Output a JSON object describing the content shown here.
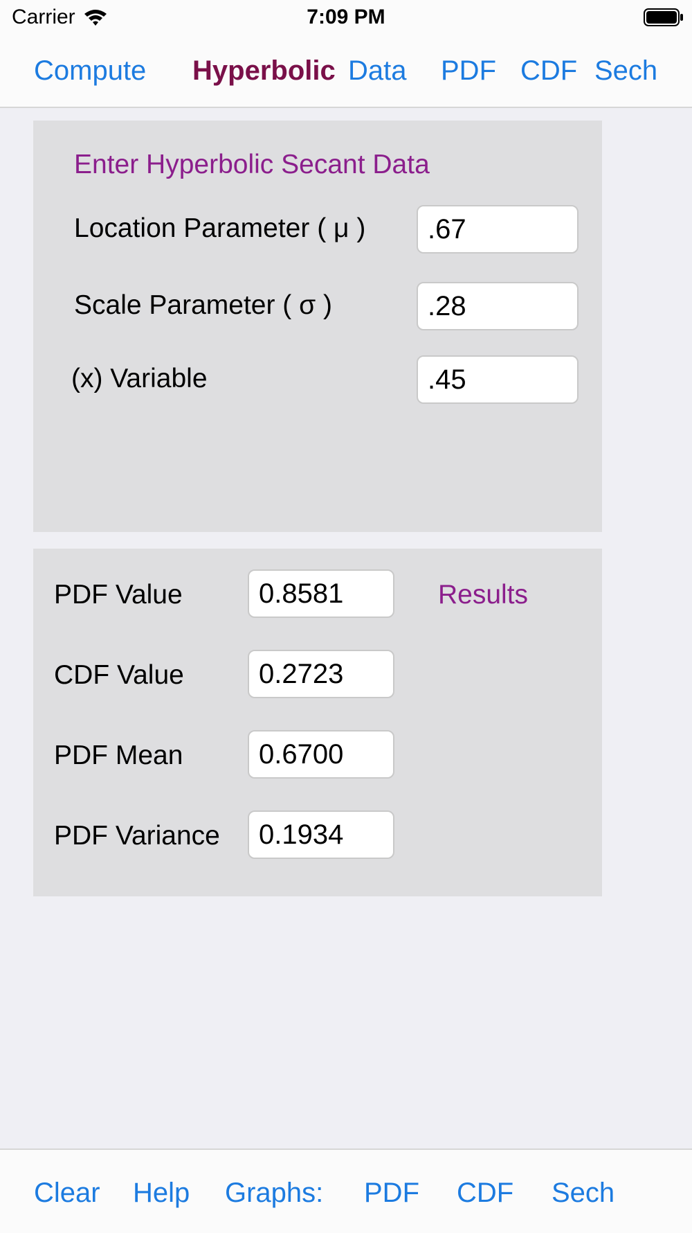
{
  "status": {
    "carrier": "Carrier",
    "time": "7:09 PM"
  },
  "nav": {
    "compute": "Compute",
    "title": "Hyperbolic",
    "data": "Data",
    "pdf": "PDF",
    "cdf": "CDF",
    "sech": "Sech"
  },
  "input_panel": {
    "title": "Enter Hyperbolic Secant Data",
    "location_label": "Location Parameter ( μ )",
    "location_value": ".67",
    "scale_label": "Scale Parameter ( σ )",
    "scale_value": ".28",
    "variable_label": "(x) Variable",
    "variable_value": ".45"
  },
  "results_panel": {
    "title": "Results",
    "pdf_value_label": "PDF Value",
    "pdf_value": "0.8581",
    "cdf_value_label": "CDF Value",
    "cdf_value": "0.2723",
    "pdf_mean_label": "PDF Mean",
    "pdf_mean": "0.6700",
    "pdf_variance_label": "PDF Variance",
    "pdf_variance": "0.1934"
  },
  "bottom": {
    "clear": "Clear",
    "help": "Help",
    "graphs": "Graphs:",
    "pdf": "PDF",
    "cdf": "CDF",
    "sech": "Sech"
  },
  "colors": {
    "accent": "#1c7be0",
    "title": "#7a1049",
    "section": "#8b1e8c",
    "panel": "#dedee0"
  }
}
